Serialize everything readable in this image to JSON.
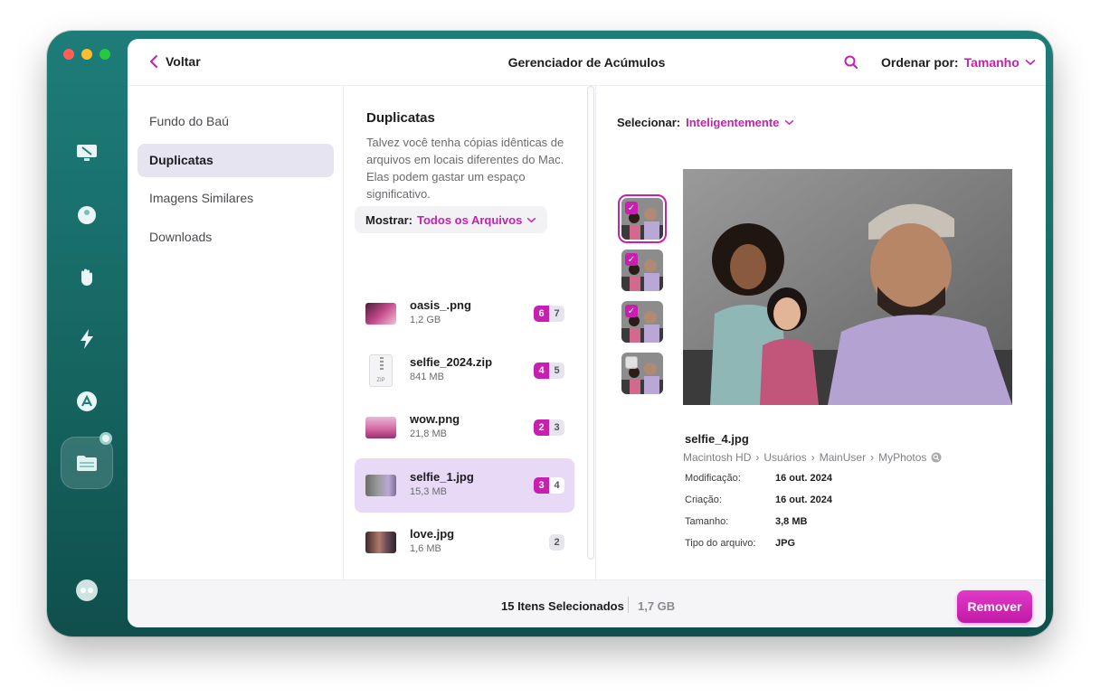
{
  "window": {
    "back_label": "Voltar",
    "title": "Gerenciador de Acúmulos",
    "sort_label": "Ordenar por:",
    "sort_value": "Tamanho"
  },
  "sidebar": {
    "items": [
      {
        "label": "Fundo do Baú"
      },
      {
        "label": "Duplicatas"
      },
      {
        "label": "Imagens Similares"
      },
      {
        "label": "Downloads"
      }
    ],
    "active_index": 1
  },
  "duplicates": {
    "title": "Duplicatas",
    "description": "Talvez você tenha cópias idênticas de arquivos em locais diferentes do Mac. Elas podem gastar um espaço significativo.",
    "show_label": "Mostrar:",
    "show_value": "Todos os Arquivos",
    "files": [
      {
        "name": "oasis_.png",
        "size": "1,2 GB",
        "selected": "6",
        "total": "7"
      },
      {
        "name": "selfie_2024.zip",
        "size": "841 MB",
        "selected": "4",
        "total": "5"
      },
      {
        "name": "wow.png",
        "size": "21,8 MB",
        "selected": "2",
        "total": "3"
      },
      {
        "name": "selfie_1.jpg",
        "size": "15,3 MB",
        "selected": "3",
        "total": "4"
      },
      {
        "name": "love.jpg",
        "size": "1,6 MB",
        "selected": "",
        "total": "2"
      }
    ],
    "zip_label": "ZIP"
  },
  "detail": {
    "select_label": "Selecionar:",
    "select_value": "Inteligentemente",
    "file_name": "selfie_4.jpg",
    "path": [
      "Macintosh HD",
      "Usuários",
      "MainUser",
      "MyPhotos"
    ],
    "meta": [
      {
        "key": "Modificação:",
        "value": "16 out. 2024"
      },
      {
        "key": "Criação:",
        "value": "16 out. 2024"
      },
      {
        "key": "Tamanho:",
        "value": "3,8 MB"
      },
      {
        "key": "Tipo do arquivo:",
        "value": "JPG"
      }
    ]
  },
  "footer": {
    "selected_count": "15 Itens Selecionados",
    "selected_size": "1,7 GB",
    "remove_label": "Remover"
  },
  "colors": {
    "accent": "#c81fb0",
    "rail": "#176a66",
    "selected_row": "#e8d9f7"
  }
}
